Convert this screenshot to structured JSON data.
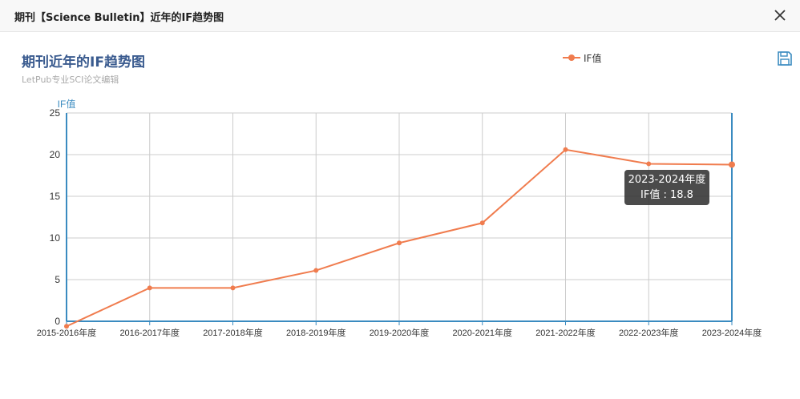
{
  "dialog": {
    "title": "期刊【Science Bulletin】近年的IF趋势图",
    "close_icon": "close-icon"
  },
  "toolbox": {
    "save_icon": "save-icon"
  },
  "colors": {
    "series": "#f07c4e",
    "axis": "#3a8bc0",
    "grid": "#cccccc",
    "title": "#3a5b8f"
  },
  "chart_data": {
    "type": "line",
    "title": "期刊近年的IF趋势图",
    "subtitle": "LetPub专业SCI论文编辑",
    "ylabel": "IF值",
    "xlabel": "",
    "ylim": [
      0,
      25
    ],
    "yticks": [
      0,
      5,
      10,
      15,
      20,
      25
    ],
    "grid": true,
    "legend_position": "top-center",
    "categories": [
      "2015-2016年度",
      "2016-2017年度",
      "2017-2018年度",
      "2018-2019年度",
      "2019-2020年度",
      "2020-2021年度",
      "2021-2022年度",
      "2022-2023年度",
      "2023-2024年度"
    ],
    "series": [
      {
        "name": "IF值",
        "values": [
          -0.6,
          4.0,
          4.0,
          6.1,
          9.4,
          11.8,
          20.6,
          18.9,
          18.8
        ]
      }
    ]
  },
  "tooltip": {
    "category": "2023-2024年度",
    "label": "IF值 : 18.8"
  }
}
